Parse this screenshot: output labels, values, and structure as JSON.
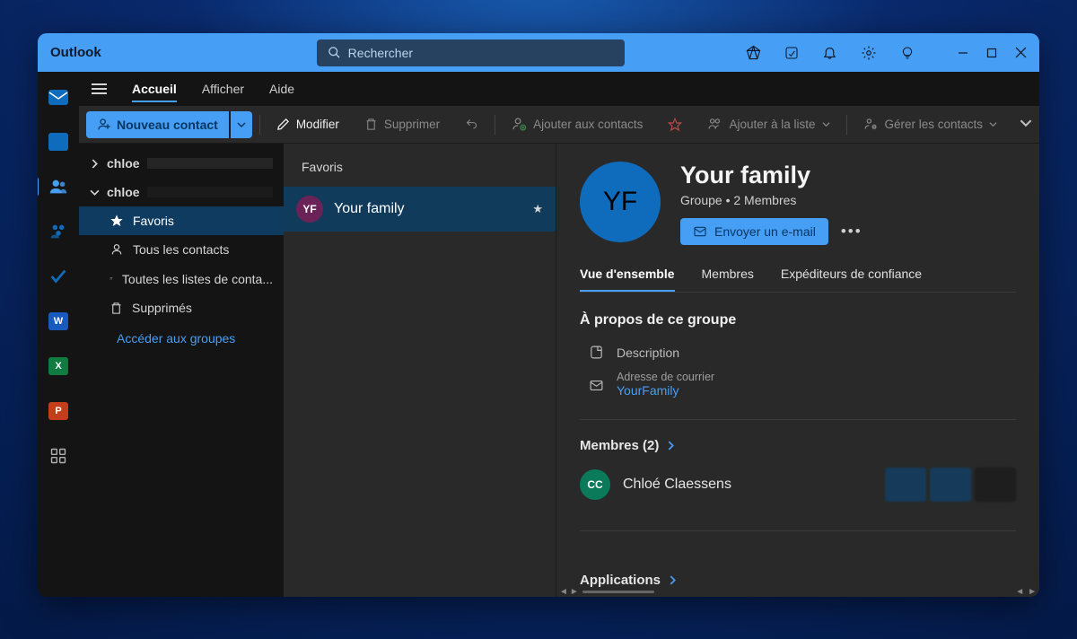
{
  "titlebar": {
    "title": "Outlook",
    "search_placeholder": "Rechercher"
  },
  "tabs": {
    "home": "Accueil",
    "view": "Afficher",
    "help": "Aide"
  },
  "toolbar": {
    "new_contact": "Nouveau contact",
    "modify": "Modifier",
    "delete": "Supprimer",
    "add_contacts": "Ajouter aux contacts",
    "add_list": "Ajouter à la liste",
    "manage": "Gérer les contacts"
  },
  "nav": {
    "acct1": "chloe",
    "acct2": "chloe",
    "favorites": "Favoris",
    "all_contacts": "Tous les contacts",
    "all_lists": "Toutes les listes de conta...",
    "deleted": "Supprimés",
    "groups_link": "Accéder aux groupes"
  },
  "list": {
    "heading": "Favoris",
    "item1_initials": "YF",
    "item1_label": "Your family"
  },
  "detail": {
    "avatar_initials": "YF",
    "title": "Your family",
    "subtitle": "Groupe • 2 Membres",
    "email_btn": "Envoyer un e-mail",
    "tabs": {
      "overview": "Vue d'ensemble",
      "members": "Membres",
      "trusted": "Expéditeurs de confiance"
    },
    "about_heading": "À propos de ce groupe",
    "description_label": "Description",
    "address_label": "Adresse de courrier",
    "address_value": "YourFamily",
    "members_heading": "Membres (2)",
    "member1_initials": "CC",
    "member1_name": "Chloé Claessens",
    "apps_heading": "Applications"
  }
}
